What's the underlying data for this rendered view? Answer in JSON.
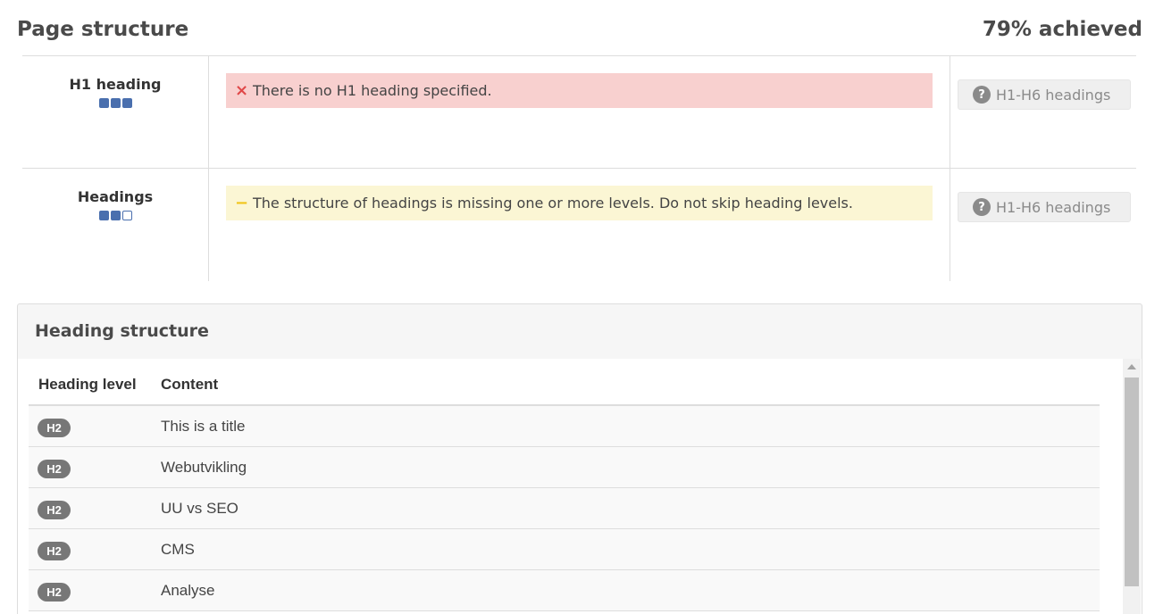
{
  "section": {
    "title": "Page structure",
    "score": "79% achieved"
  },
  "checks": [
    {
      "name": "H1 heading",
      "rating": [
        true,
        true,
        true
      ],
      "status": "error",
      "icon": "×",
      "message": "There is no H1 heading specified.",
      "help_label": "H1-H6 headings"
    },
    {
      "name": "Headings",
      "rating": [
        true,
        true,
        false
      ],
      "status": "warning",
      "icon": "−",
      "message": "The structure of headings is missing one or more levels. Do not skip heading levels.",
      "help_label": "H1-H6 headings"
    }
  ],
  "heading_structure": {
    "title": "Heading structure",
    "columns": [
      "Heading level",
      "Content"
    ],
    "rows": [
      {
        "level": "H2",
        "content": "This is a title"
      },
      {
        "level": "H2",
        "content": "Webutvikling"
      },
      {
        "level": "H2",
        "content": "UU vs SEO"
      },
      {
        "level": "H2",
        "content": "CMS"
      },
      {
        "level": "H2",
        "content": "Analyse"
      }
    ]
  },
  "colors": {
    "error_bg": "#f8d0cf",
    "warning_bg": "#fbf6d4",
    "rating_fill": "#4a6fae",
    "badge_bg": "#777777"
  }
}
